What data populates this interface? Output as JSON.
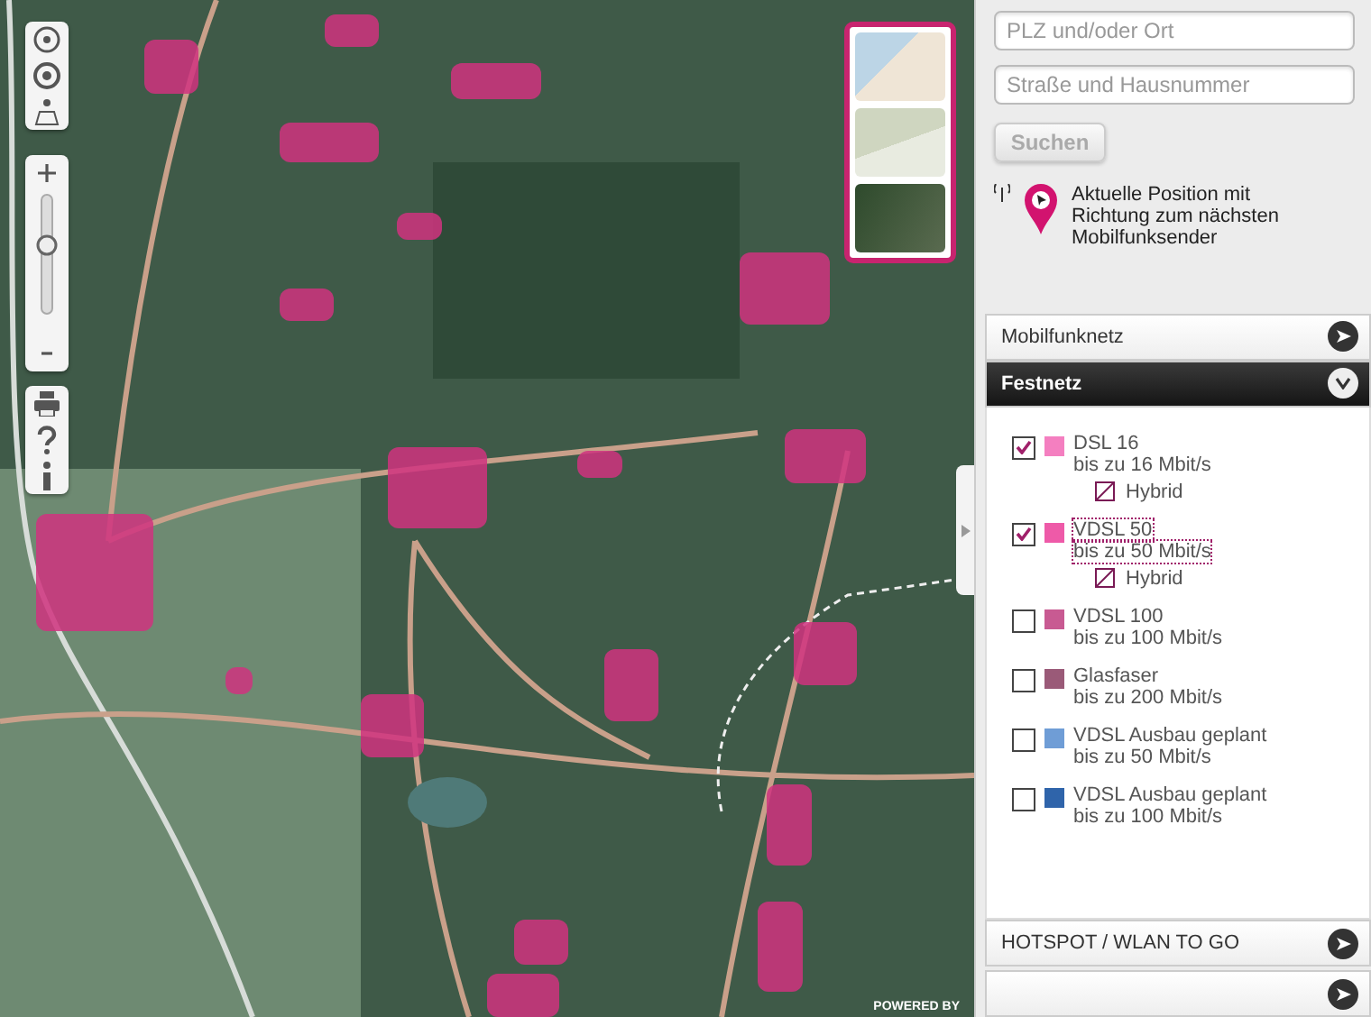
{
  "map_controls": {
    "credit": "POWERED BY"
  },
  "search": {
    "place": {
      "placeholder": "PLZ und/oder Ort"
    },
    "street": {
      "placeholder": "Straße und Hausnummer"
    },
    "button": "Suchen"
  },
  "legend_note": "Aktuelle Position mit Richtung zum nächsten Mobilfunksender",
  "sections": [
    {
      "title": "Mobilfunknetz",
      "expanded": false
    },
    {
      "title": "Festnetz",
      "expanded": true
    },
    {
      "title": "HOTSPOT / WLAN TO GO",
      "expanded": false
    }
  ],
  "layers": [
    {
      "name": "DSL 16",
      "speed": "bis zu 16 Mbit/s",
      "checked": true,
      "color": "#f47fc0",
      "hybrid": "Hybrid",
      "focused": false
    },
    {
      "name": "VDSL 50",
      "speed": "bis zu 50 Mbit/s",
      "checked": true,
      "color": "#ee5aa8",
      "hybrid": "Hybrid",
      "focused": true
    },
    {
      "name": "VDSL 100",
      "speed": "bis zu 100 Mbit/s",
      "checked": false,
      "color": "#c85a92",
      "focused": false
    },
    {
      "name": "Glasfaser",
      "speed": "bis zu 200 Mbit/s",
      "checked": false,
      "color": "#9a5a78",
      "focused": false
    },
    {
      "name": "VDSL Ausbau geplant",
      "speed": "bis zu 50 Mbit/s",
      "checked": false,
      "color": "#6f9dd6",
      "focused": false
    },
    {
      "name": "VDSL Ausbau geplant",
      "speed": "bis zu 100 Mbit/s",
      "checked": false,
      "color": "#2f64aa",
      "focused": false
    }
  ]
}
